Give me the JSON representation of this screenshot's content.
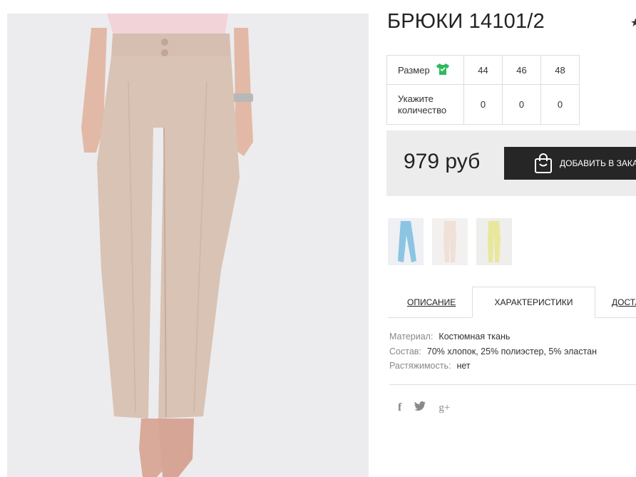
{
  "product": {
    "title": "БРЮКИ 14101/2",
    "photo_alt": "product-photo"
  },
  "sizes": {
    "size_label": "Размер",
    "size_icon": "tshirt-icon",
    "qty_label": "Укажите количество",
    "values": [
      "44",
      "46",
      "48"
    ],
    "quantities": [
      "0",
      "0",
      "0"
    ]
  },
  "buy": {
    "price": "979 руб",
    "button_label": "ДОБАВИТЬ В ЗАКАЗ"
  },
  "tabs": [
    {
      "label": "ОПИСАНИЕ"
    },
    {
      "label": "ХАРАКТЕРИСТИКИ"
    },
    {
      "label": "ДОСТАВКА"
    }
  ],
  "specs": [
    {
      "key": "Материал:",
      "value": "Костюмная ткань"
    },
    {
      "key": "Состав:",
      "value": "70% хлопок, 25% полиэстер, 5% эластан"
    },
    {
      "key": "Растяжимость:",
      "value": "нет"
    }
  ],
  "social": {
    "facebook": "f",
    "twitter": "twitter-icon",
    "gplus": "g+"
  },
  "colors": {
    "accent_dark": "#262626",
    "size_icon_green": "#2dbb5d",
    "pants_beige": "#d9c3b5"
  }
}
